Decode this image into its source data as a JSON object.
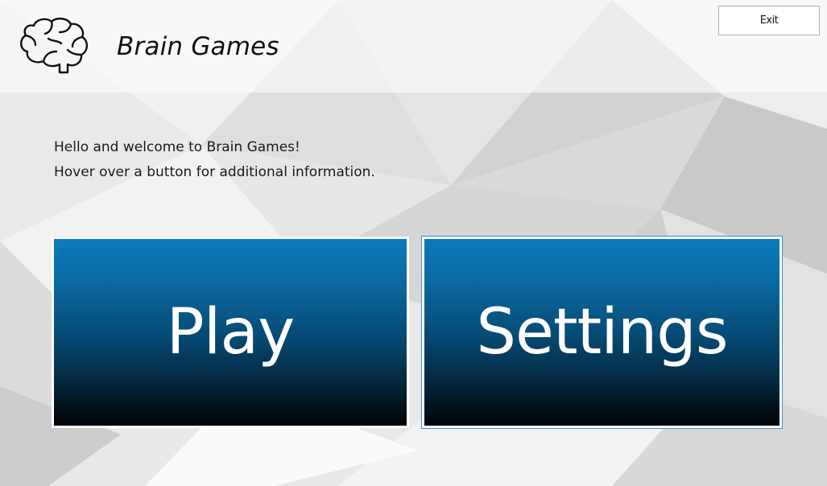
{
  "app": {
    "title": "Brain Games",
    "icon": "brain-icon"
  },
  "toolbar": {
    "exit_label": "Exit"
  },
  "welcome": {
    "line1": "Hello and welcome to Brain Games!",
    "line2": "Hover over a button for additional information."
  },
  "buttons": {
    "play_label": "Play",
    "settings_label": "Settings"
  },
  "colors": {
    "button_top": "#0a7cbe",
    "button_bottom": "#010305",
    "focus_outline": "#3b8fd0",
    "background": "#dcdcdc"
  }
}
